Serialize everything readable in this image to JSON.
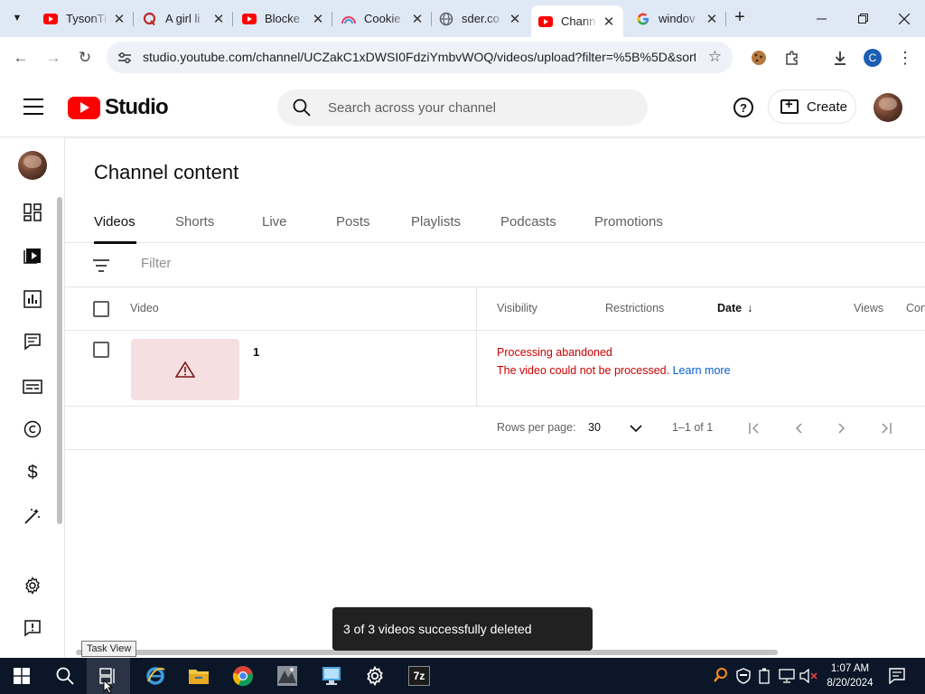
{
  "browser": {
    "tabs": [
      {
        "title": "TysonTi",
        "favicon": "youtube-favicon"
      },
      {
        "title": "A girl li",
        "favicon": "quora-favicon"
      },
      {
        "title": "Blocke",
        "favicon": "youtube-favicon"
      },
      {
        "title": "Cookie",
        "favicon": "rainbow-favicon"
      },
      {
        "title": "sder.co",
        "favicon": "globe-favicon"
      },
      {
        "title": "Chann",
        "favicon": "youtube-favicon",
        "active": true
      },
      {
        "title": "windov",
        "favicon": "google-favicon"
      }
    ],
    "url": "studio.youtube.com/channel/UCZakC1xDWSI0FdziYmbvWOQ/videos/upload?filter=%5B%5D&sort...",
    "profile_initial": "C"
  },
  "header": {
    "logo_text": "Studio",
    "search_placeholder": "Search across your channel",
    "create_label": "Create",
    "help_glyph": "?"
  },
  "page": {
    "title": "Channel content",
    "tabs": [
      "Videos",
      "Shorts",
      "Live",
      "Posts",
      "Playlists",
      "Podcasts",
      "Promotions"
    ],
    "active_tab": "Videos",
    "filter_placeholder": "Filter"
  },
  "table": {
    "columns": {
      "video": "Video",
      "visibility": "Visibility",
      "restrictions": "Restrictions",
      "date": "Date",
      "views": "Views",
      "comments": "Con"
    },
    "rows": [
      {
        "title": "1",
        "status_title": "Processing abandoned",
        "status_detail": "The video could not be processed.",
        "learn_more": "Learn more"
      }
    ]
  },
  "pagination": {
    "rows_per_page_label": "Rows per page:",
    "rows_per_page_value": "30",
    "range": "1–1 of 1"
  },
  "snackbar": {
    "message": "3 of 3 videos successfully deleted"
  },
  "tooltip": {
    "text": "Task View"
  },
  "taskbar": {
    "time": "1:07 AM",
    "date": "8/20/2024",
    "app_7z_label": "7z"
  },
  "colors": {
    "youtube_red": "#ff0000",
    "error_red": "#cc0000",
    "link_blue": "#065fd4",
    "taskbar_bg": "#0b1728"
  }
}
